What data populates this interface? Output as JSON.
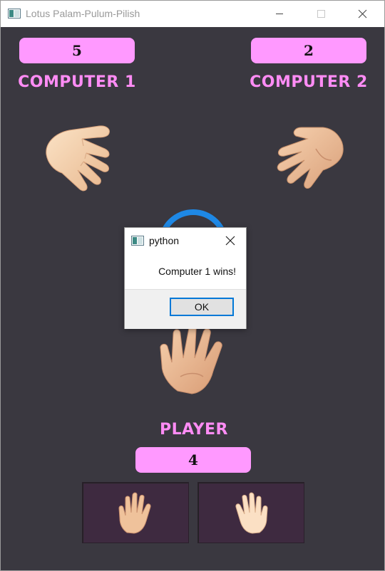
{
  "window": {
    "title": "Lotus Palam-Pulum-Pilish"
  },
  "scores": {
    "computer1": "5",
    "computer2": "2",
    "player": "4"
  },
  "labels": {
    "computer1": "COMPUTER 1",
    "computer2": "COMPUTER 2",
    "player": "PLAYER"
  },
  "dialog": {
    "title": "python",
    "message": "Computer 1 wins!",
    "ok_label": "OK"
  },
  "colors": {
    "background": "#3a3840",
    "pill": "#ff99ff",
    "label": "#ff8cf5",
    "spinner": "#1e88e5"
  },
  "icons": {
    "computer1_hand": "hand-palm-down-icon",
    "computer2_hand": "hand-palm-up-icon",
    "player_hand": "hand-palm-up-icon",
    "choice1": "raised-hand-icon",
    "choice2": "raised-back-of-hand-icon"
  }
}
